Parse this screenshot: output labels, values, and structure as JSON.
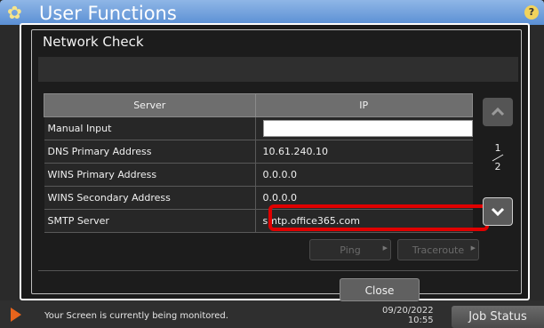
{
  "app": {
    "title": "User Functions",
    "help_label": "?"
  },
  "status_bar": {
    "message": "Your Screen is currently being monitored.",
    "date": "09/20/2022",
    "time": "10:55",
    "job_status_label": "Job Status"
  },
  "dialog": {
    "title": "Network Check",
    "table": {
      "headers": [
        "Server",
        "IP"
      ],
      "rows": [
        {
          "server": "Manual Input",
          "ip": ""
        },
        {
          "server": "DNS Primary Address",
          "ip": "10.61.240.10"
        },
        {
          "server": "WINS Primary Address",
          "ip": "0.0.0.0"
        },
        {
          "server": "WINS Secondary Address",
          "ip": "0.0.0.0"
        },
        {
          "server": "SMTP Server",
          "ip": "smtp.office365.com"
        }
      ]
    },
    "page": {
      "current": "1",
      "total": "2"
    },
    "buttons": {
      "ping": "Ping",
      "traceroute": "Traceroute",
      "close": "Close"
    }
  },
  "colors": {
    "highlight": "#e00000",
    "accent_orange": "#e8641c",
    "title_blue": "#5a8fd4"
  }
}
